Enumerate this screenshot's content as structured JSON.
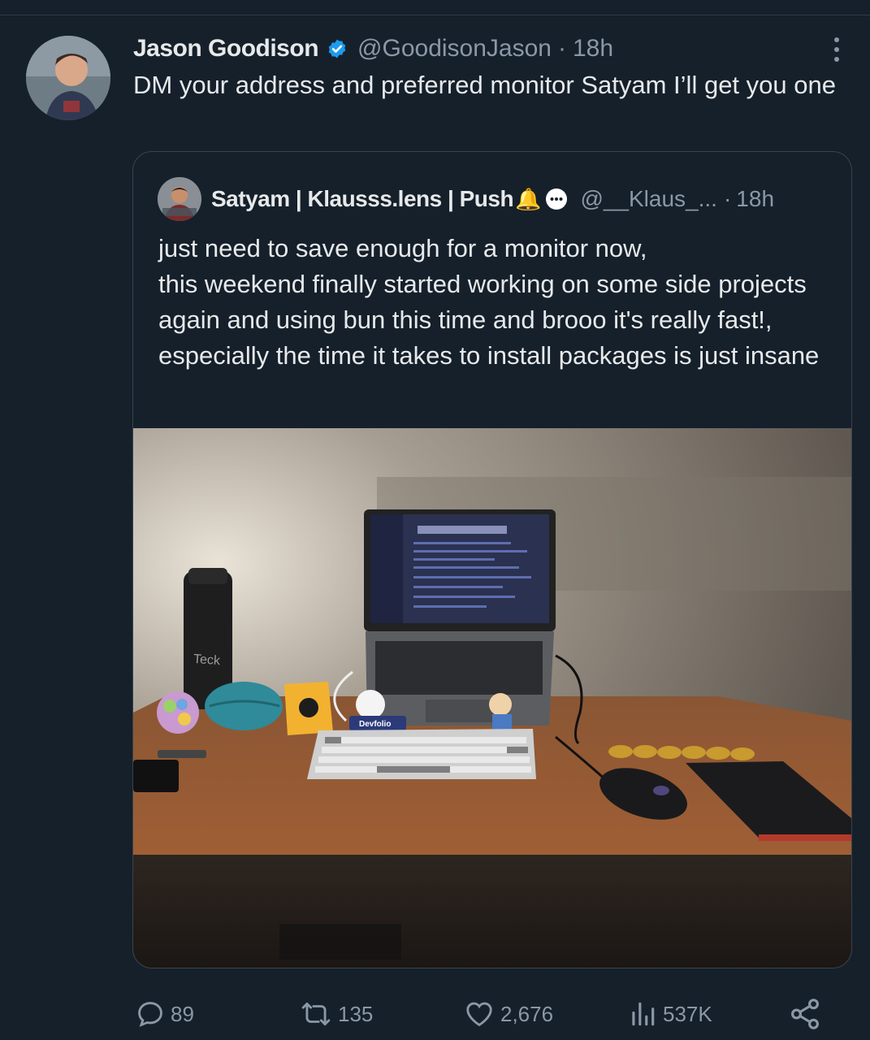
{
  "tweet": {
    "author_name": "Jason Goodison",
    "handle": "@GoodisonJason",
    "separator": "·",
    "time": "18h",
    "text": "DM your address and preferred monitor Satyam I’ll get you one"
  },
  "quoted_tweet": {
    "author_name": "Satyam | Klausss.lens | Push",
    "emoji": "🔔",
    "handle": "@__Klaus_...",
    "separator": "·",
    "time": "18h",
    "text": "just need to save enough for a monitor now,\nthis weekend finally started working on some side projects again and using bun this time and brooo it's really fast!, especially the time it takes to install packages is just insane",
    "photo_labels": {
      "bottle": "Teck",
      "sticker": "Devfolio"
    }
  },
  "actions": {
    "replies": "89",
    "reposts": "135",
    "likes": "2,676",
    "views": "537K"
  },
  "colors": {
    "background": "#15202b",
    "text": "#e7e9ea",
    "muted": "#8b98a5",
    "verified": "#1d9bf0",
    "border": "#38444d"
  },
  "icons": [
    "verified-icon",
    "more-icon",
    "reply-icon",
    "repost-icon",
    "like-icon",
    "views-icon",
    "share-icon"
  ]
}
